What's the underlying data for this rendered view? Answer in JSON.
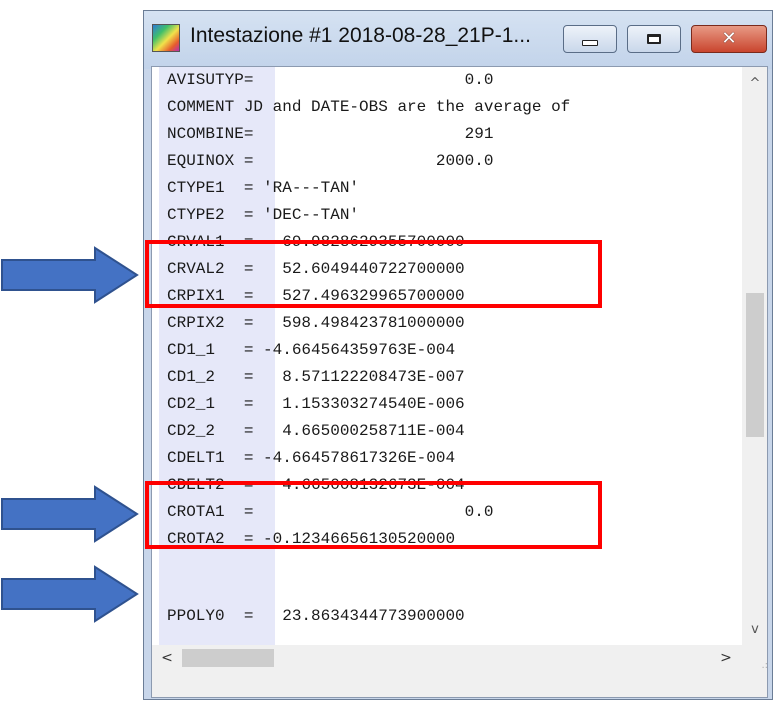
{
  "window": {
    "title": "Intestazione #1 2018-08-28_21P-1...",
    "icon": "fits-header-app-icon",
    "controls": {
      "minimize_icon": "minimize-icon",
      "maximize_icon": "maximize-icon",
      "close_label": "✕"
    }
  },
  "header_lines": [
    "AVISUTYP=                      0.0",
    "COMMENT JD and DATE-OBS are the average of",
    "NCOMBINE=                      291",
    "EQUINOX =                   2000.0",
    "CTYPE1  = 'RA---TAN'",
    "CTYPE2  = 'DEC--TAN'",
    "CRVAL1  =   69.9828629355700000",
    "CRVAL2  =   52.6049440722700000",
    "CRPIX1  =   527.496329965700000",
    "CRPIX2  =   598.498423781000000",
    "CD1_1   = -4.664564359763E-004",
    "CD1_2   =   8.571122208473E-007",
    "CD2_1   =   1.153303274540E-006",
    "CD2_2   =   4.665000258711E-004",
    "CDELT1  = -4.664578617326E-004",
    "CDELT2  =   4.665008132673E-004",
    "CROTA1  =                      0.0",
    "CROTA2  = -0.12346656130520000",
    "",
    "PPOLY0  =   23.8634344773900000"
  ],
  "scrollbars": {
    "up_arrow": "^",
    "down_arrow": "v",
    "left_arrow": "<",
    "right_arrow": ">",
    "grip": ".:"
  },
  "annotations": {
    "highlight_color": "#ff0000",
    "arrow_color": "#4472c4",
    "arrow_outline": "#2f528f"
  }
}
